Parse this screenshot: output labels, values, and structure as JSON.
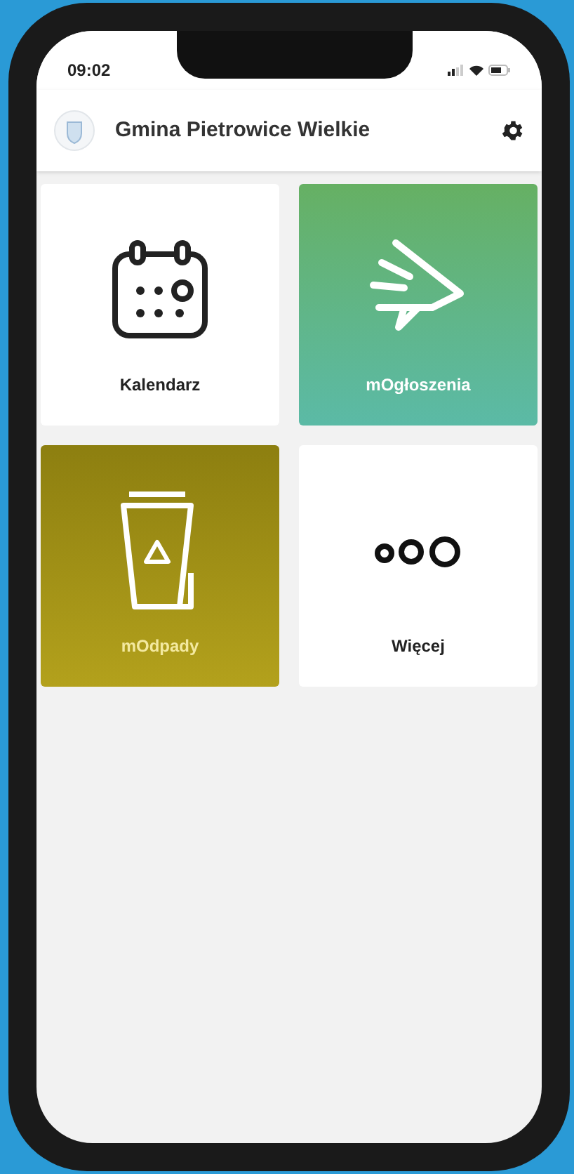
{
  "status_bar": {
    "time": "09:02"
  },
  "header": {
    "title": "Gmina Pietrowice Wielkie"
  },
  "tiles": [
    {
      "kind": "calendar",
      "label": "Kalendarz"
    },
    {
      "kind": "announcements",
      "label": "mOgłoszenia"
    },
    {
      "kind": "waste",
      "label": "mOdpady"
    },
    {
      "kind": "more",
      "label": "Więcej"
    }
  ]
}
